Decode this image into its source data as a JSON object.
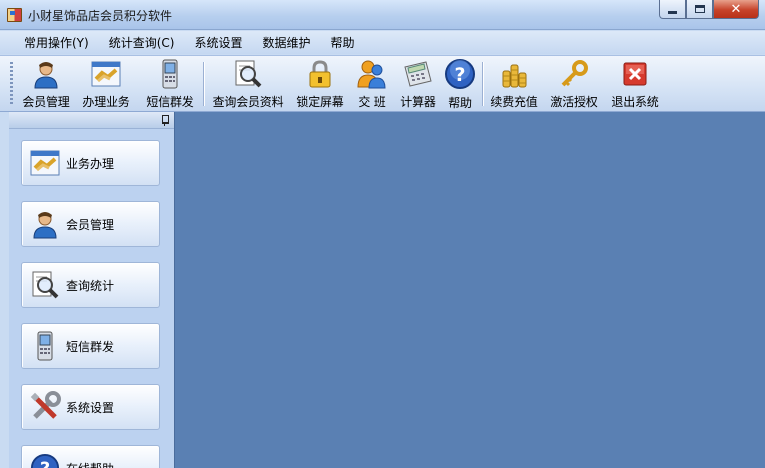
{
  "window": {
    "title": "小财星饰品店会员积分软件"
  },
  "menu": {
    "items": [
      "常用操作(Y)",
      "统计查询(C)",
      "系统设置",
      "数据维护",
      "帮助"
    ]
  },
  "toolbar": {
    "items": [
      {
        "label": "会员管理",
        "icon": "person-icon"
      },
      {
        "label": "办理业务",
        "icon": "handshake-icon"
      },
      {
        "label": "短信群发",
        "icon": "mobile-phone-icon"
      },
      {
        "label": "查询会员资料",
        "icon": "magnifier-icon"
      },
      {
        "label": "锁定屏幕",
        "icon": "padlock-icon"
      },
      {
        "label": "交 班",
        "icon": "users-icon"
      },
      {
        "label": "计算器",
        "icon": "calculator-icon"
      },
      {
        "label": "帮助",
        "icon": "help-icon"
      },
      {
        "label": "续费充值",
        "icon": "coins-icon"
      },
      {
        "label": "激活授权",
        "icon": "key-icon"
      },
      {
        "label": "退出系统",
        "icon": "exit-icon"
      }
    ]
  },
  "sidebar": {
    "items": [
      {
        "label": "业务办理",
        "icon": "handshake-icon"
      },
      {
        "label": "会员管理",
        "icon": "person-icon"
      },
      {
        "label": "查询统计",
        "icon": "magnifier-icon"
      },
      {
        "label": "短信群发",
        "icon": "mobile-phone-icon"
      },
      {
        "label": "系统设置",
        "icon": "tools-icon"
      },
      {
        "label": "在线帮助",
        "icon": "help-icon"
      }
    ]
  },
  "colors": {
    "workspace": "#5a80b3",
    "panel": "#bcd2f0",
    "toolbar": "#d5e3f5",
    "close_button": "#c7432a"
  }
}
